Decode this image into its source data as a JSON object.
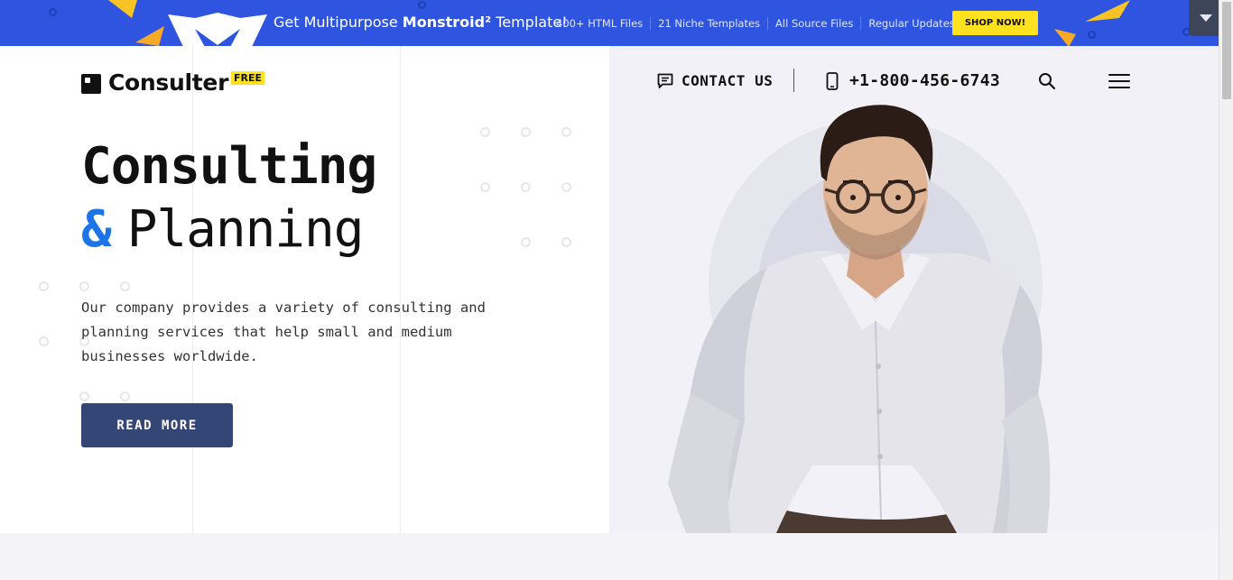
{
  "promo": {
    "text_prefix": "Get Multipurpose ",
    "text_brand": "Monstroid²",
    "text_suffix": " Template!",
    "features": [
      "400+ HTML Files",
      "21 Niche Templates",
      "All Source Files",
      "Regular Updates"
    ],
    "shop_label": "SHOP NOW!",
    "toggle_icon": "chevron-down-icon",
    "colors": {
      "background": "#2f55e0",
      "accent": "#ffe21f"
    }
  },
  "header": {
    "logo_text": "Consulter",
    "logo_badge": "FREE",
    "contact_label": "CONTACT US",
    "contact_icon": "chat-icon",
    "phone": "+1-800-456-6743",
    "phone_icon": "smartphone-icon",
    "search_icon": "search-icon",
    "menu_icon": "hamburger-menu-icon"
  },
  "hero": {
    "title_line1": "Consulting",
    "title_amp": "&",
    "title_line2": "Planning",
    "lead": "Our company provides a variety of consulting and planning services that help small and medium businesses worldwide.",
    "cta_label": "READ MORE",
    "image_alt": "consultant-portrait",
    "colors": {
      "amp": "#1d73e8",
      "cta": "#344676"
    }
  }
}
